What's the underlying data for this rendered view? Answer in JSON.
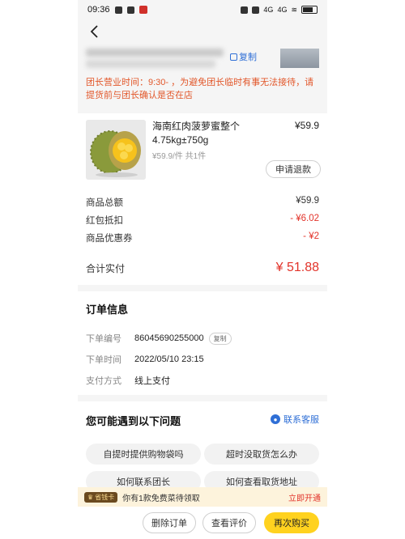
{
  "status_bar": {
    "time": "09:36",
    "signal1": "4G",
    "signal2": "4G"
  },
  "pickup": {
    "copy_label": "复制",
    "notice": "团长营业时间：9:30-    ，为避免团长临时有事无法接待，请提货前与团长确认是否在店"
  },
  "product": {
    "name": "海南红肉菠萝蜜整个4.75kg±750g",
    "price": "¥59.9",
    "meta": "¥59.9/件   共1件",
    "refund_label": "申请退款"
  },
  "pricing": {
    "rows": [
      {
        "label": "商品总额",
        "value": "¥59.9"
      },
      {
        "label": "红包抵扣",
        "value": "- ¥6.02"
      },
      {
        "label": "商品优惠券",
        "value": "- ¥2"
      }
    ],
    "total_label": "合计实付",
    "total_value": "¥ 51.88"
  },
  "order_info": {
    "title": "订单信息",
    "rows": [
      {
        "label": "下单编号",
        "value": "86045690255000"
      },
      {
        "label": "下单时间",
        "value": "2022/05/10 23:15"
      },
      {
        "label": "支付方式",
        "value": "线上支付"
      }
    ],
    "copy_label": "复制"
  },
  "faq": {
    "title": "您可能遇到以下问题",
    "service_label": "联系客服",
    "items": [
      "自提时提供购物袋吗",
      "超时没取货怎么办",
      "如何联系团长",
      "如何查看取货地址"
    ]
  },
  "member": {
    "badge": "省钱卡",
    "text": "你有1款免费菜待领取",
    "cta": "立即开通"
  },
  "actions": {
    "delete": "删除订单",
    "review": "查看评价",
    "rebuy": "再次购买"
  },
  "colors": {
    "accent_red": "#e2332a",
    "notice_orange": "#e2572a",
    "link_blue": "#2f6fd6",
    "primary_yellow": "#ffd21f"
  }
}
